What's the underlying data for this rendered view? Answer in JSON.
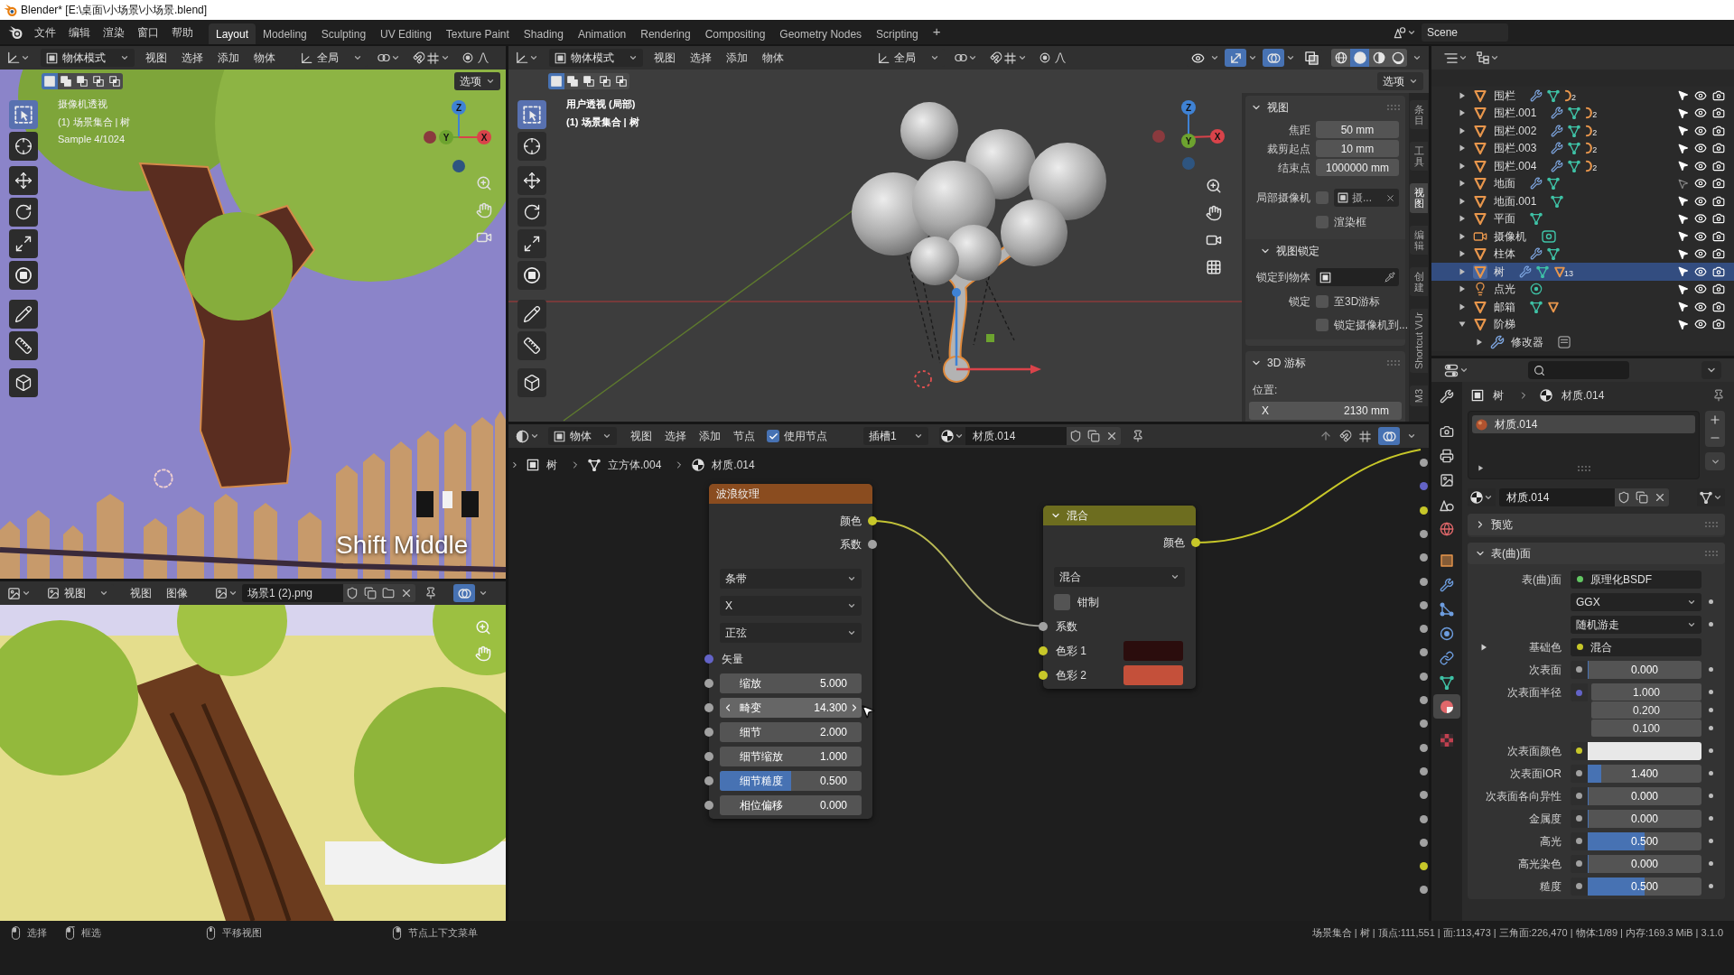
{
  "title_bar": {
    "title": "Blender* [E:\\桌面\\小场景\\小场景.blend]"
  },
  "top_bar": {
    "menus": [
      "文件",
      "编辑",
      "渲染",
      "窗口",
      "帮助"
    ],
    "workspaces": [
      {
        "label": "Layout",
        "selected": true
      },
      {
        "label": "Modeling",
        "selected": false
      },
      {
        "label": "Sculpting",
        "selected": false
      },
      {
        "label": "UV Editing",
        "selected": false
      },
      {
        "label": "Texture Paint",
        "selected": false
      },
      {
        "label": "Shading",
        "selected": false
      },
      {
        "label": "Animation",
        "selected": false
      },
      {
        "label": "Rendering",
        "selected": false
      },
      {
        "label": "Compositing",
        "selected": false
      },
      {
        "label": "Geometry Nodes",
        "selected": false
      },
      {
        "label": "Scripting",
        "selected": false
      }
    ],
    "add_workspace": "+",
    "scene": "Scene"
  },
  "camera_view": {
    "header": {
      "mode": "物体模式",
      "menus": [
        "视图",
        "选择",
        "添加",
        "物体"
      ],
      "orientation": "全局"
    },
    "select_modes": [
      {
        "kind": "set",
        "selected": true
      },
      {
        "kind": "extend",
        "selected": false
      },
      {
        "kind": "subtract",
        "selected": false
      },
      {
        "kind": "difference",
        "selected": false
      },
      {
        "kind": "intersect",
        "selected": false
      }
    ],
    "options": "选项",
    "tools": [
      {
        "kind": "select",
        "selected": true
      },
      {
        "kind": "cursor",
        "selected": false
      },
      {
        "kind": "move",
        "selected": false
      },
      {
        "kind": "rotate",
        "selected": false
      },
      {
        "kind": "scale",
        "selected": false
      },
      {
        "kind": "transform",
        "selected": false
      },
      {
        "kind": "annotate",
        "selected": false
      },
      {
        "kind": "measure",
        "selected": false
      },
      {
        "kind": "add_cube",
        "selected": false
      }
    ],
    "info": [
      "摄像机透视",
      "(1) 场景集合 | 树",
      "Sample 4/1024"
    ],
    "gizmo": {
      "labels": [
        {
          "kind": "z",
          "text": "Z"
        },
        {
          "kind": "y",
          "text": "Y"
        },
        {
          "kind": "x",
          "text": "X"
        }
      ]
    },
    "key_hint": {
      "text": "Shift Middle",
      "buttons": [
        {
          "pressed": false
        },
        {
          "pressed": true
        },
        {
          "pressed": false
        }
      ]
    }
  },
  "image_editor": {
    "header": {
      "mode": "视图",
      "menus": [
        "视图",
        "图像"
      ],
      "image": "场景1 (2).png"
    }
  },
  "viewport": {
    "header": {
      "mode": "物体模式",
      "menus": [
        "视图",
        "选择",
        "添加",
        "物体"
      ],
      "orientation": "全局",
      "toggles": [
        {
          "kind": "visibility",
          "selected": false
        },
        {
          "kind": "gizmo",
          "selected": true
        },
        {
          "kind": "overlay",
          "selected": true
        },
        {
          "kind": "xray",
          "selected": false
        }
      ],
      "shading_modes": [
        {
          "kind": "wireframe",
          "selected": false
        },
        {
          "kind": "solid",
          "selected": true
        },
        {
          "kind": "material",
          "selected": false
        },
        {
          "kind": "rendered",
          "selected": false
        }
      ]
    },
    "select_modes": [
      {
        "kind": "set",
        "selected": true
      },
      {
        "kind": "extend",
        "selected": false
      },
      {
        "kind": "subtract",
        "selected": false
      },
      {
        "kind": "difference",
        "selected": false
      },
      {
        "kind": "intersect",
        "selected": false
      }
    ],
    "options": "选项",
    "tools": [
      {
        "kind": "select",
        "selected": true
      },
      {
        "kind": "cursor",
        "selected": false
      },
      {
        "kind": "move",
        "selected": false
      },
      {
        "kind": "rotate",
        "selected": false
      },
      {
        "kind": "scale",
        "selected": false
      },
      {
        "kind": "transform",
        "selected": false
      },
      {
        "kind": "annotate",
        "selected": false
      },
      {
        "kind": "measure",
        "selected": false
      },
      {
        "kind": "add_cube",
        "selected": false
      }
    ],
    "info": [
      "用户透视 (局部)",
      "(1) 场景集合 | 树"
    ],
    "gizmo": {
      "labels": [
        {
          "kind": "z",
          "text": "Z"
        },
        {
          "kind": "y",
          "text": "Y"
        },
        {
          "kind": "x",
          "text": "X"
        }
      ]
    },
    "sidebar": {
      "tabs": [
        {
          "label": "条目",
          "kind": "stacked",
          "selected": false
        },
        {
          "label": "工具",
          "kind": "stacked",
          "selected": false
        },
        {
          "label": "视图",
          "kind": "stacked",
          "selected": true
        },
        {
          "label": "编辑",
          "kind": "stacked",
          "selected": false
        },
        {
          "label": "创建",
          "kind": "stacked",
          "selected": false
        },
        {
          "label": "Shortcut VUr",
          "kind": "rotated",
          "selected": false
        },
        {
          "label": "M3",
          "kind": "rotated",
          "selected": false
        }
      ],
      "panels": [
        {
          "title": "视图",
          "expanded": true,
          "rows": [
            {
              "kind": "value",
              "label": "焦距",
              "value": "50 mm"
            },
            {
              "kind": "value",
              "label": "裁剪起点",
              "value": "10 mm"
            },
            {
              "kind": "value",
              "label": "结束点",
              "value": "1000000 mm"
            },
            {
              "kind": "camera",
              "label": "局部摄像机",
              "checked": false,
              "value": "摄..."
            },
            {
              "kind": "check",
              "text": "渲染框",
              "checked": false
            }
          ],
          "subpanels": [
            {
              "title": "视图锁定",
              "expanded": true,
              "rows": [
                {
                  "kind": "object",
                  "label": "锁定到物体"
                },
                {
                  "kind": "check",
                  "label": "锁定",
                  "text": "至3D游标",
                  "checked": false
                },
                {
                  "kind": "check",
                  "text": "锁定摄像机到...",
                  "checked": false
                }
              ]
            }
          ]
        },
        {
          "title": "3D 游标",
          "expanded": true,
          "rows": [
            {
              "kind": "heading",
              "label": "位置:"
            },
            {
              "kind": "axis",
              "label": "X",
              "value": "2130 mm"
            }
          ]
        }
      ]
    }
  },
  "node_editor": {
    "header": {
      "mode": "物体",
      "menus": [
        "视图",
        "选择",
        "添加",
        "节点"
      ],
      "use_nodes": {
        "label": "使用节点",
        "checked": true
      },
      "slot": "插槽1",
      "material": "材质.014"
    },
    "breadcrumb": [
      "树",
      "立方体.004",
      "材质.014"
    ],
    "nodes": [
      {
        "kind": "texture",
        "title": "波浪纹理",
        "outputs": [
          {
            "label": "颜色",
            "socket": {
              "color": "#c7c729"
            }
          },
          {
            "label": "系数",
            "socket": {
              "color": "#a1a1a1"
            }
          }
        ],
        "dropdowns": [
          "条带",
          "X",
          "正弦"
        ],
        "inputs": [
          {
            "kind": "socket",
            "label": "矢量",
            "socket": {
              "color": "#6363c7"
            }
          },
          {
            "kind": "value",
            "label": "缩放",
            "value": "5.000",
            "socket": {
              "color": "#a1a1a1"
            },
            "hovered": false
          },
          {
            "kind": "value",
            "label": "畸变",
            "value": "14.300",
            "socket": {
              "color": "#a1a1a1"
            },
            "hovered": true
          },
          {
            "kind": "value",
            "label": "细节",
            "value": "2.000",
            "socket": {
              "color": "#a1a1a1"
            },
            "hovered": false
          },
          {
            "kind": "value",
            "label": "细节缩放",
            "value": "1.000",
            "socket": {
              "color": "#a1a1a1"
            },
            "hovered": false
          },
          {
            "kind": "factor",
            "label": "细节糙度",
            "value": "0.500",
            "level": 0.5,
            "socket": {
              "color": "#a1a1a1"
            },
            "hovered": false
          },
          {
            "kind": "value",
            "label": "相位偏移",
            "value": "0.000",
            "socket": {
              "color": "#a1a1a1"
            },
            "hovered": false
          }
        ]
      },
      {
        "kind": "color",
        "title": "混合",
        "expanded": true,
        "outputs": [
          {
            "label": "颜色",
            "socket": {
              "color": "#c7c729"
            }
          }
        ],
        "dropdowns": [
          "混合"
        ],
        "checkboxes": [
          {
            "label": "钳制",
            "checked": false
          }
        ],
        "inputs": [
          {
            "kind": "socket",
            "label": "系数",
            "socket": {
              "color": "#a1a1a1"
            }
          },
          {
            "kind": "color",
            "label": "色彩 1",
            "socket": {
              "color": "#c7c729"
            },
            "color": "#2b0d0d"
          },
          {
            "kind": "color",
            "label": "色彩 2",
            "socket": {
              "color": "#c7c729"
            },
            "color": "#c4503a"
          }
        ]
      }
    ],
    "edge_sockets": [
      {
        "color": "#a1a1a1"
      },
      {
        "color": "#6363c7"
      },
      {
        "color": "#c7c729"
      },
      {
        "color": "#a1a1a1"
      },
      {
        "color": "#a1a1a1"
      },
      {
        "color": "#a1a1a1"
      },
      {
        "color": "#a1a1a1"
      },
      {
        "color": "#a1a1a1"
      },
      {
        "color": "#a1a1a1"
      },
      {
        "color": "#a1a1a1"
      },
      {
        "color": "#a1a1a1"
      },
      {
        "color": "#a1a1a1"
      },
      {
        "color": "#a1a1a1"
      },
      {
        "color": "#a1a1a1"
      },
      {
        "color": "#a1a1a1"
      },
      {
        "color": "#a1a1a1"
      },
      {
        "color": "#a1a1a1"
      },
      {
        "color": "#c7c729"
      },
      {
        "color": "#a1a1a1"
      }
    ]
  },
  "outliner": {
    "rows": [
      {
        "name": "围栏",
        "kind": "mesh",
        "expanded": false,
        "selected": false,
        "selectable": true,
        "data": [
          {
            "kind": "modifier"
          },
          {
            "kind": "mesh_data"
          },
          {
            "kind": "hook",
            "count": "2"
          }
        ]
      },
      {
        "name": "围栏.001",
        "kind": "mesh",
        "expanded": false,
        "selected": false,
        "selectable": true,
        "data": [
          {
            "kind": "modifier"
          },
          {
            "kind": "mesh_data"
          },
          {
            "kind": "hook",
            "count": "2"
          }
        ]
      },
      {
        "name": "围栏.002",
        "kind": "mesh",
        "expanded": false,
        "selected": false,
        "selectable": true,
        "data": [
          {
            "kind": "modifier"
          },
          {
            "kind": "mesh_data"
          },
          {
            "kind": "hook",
            "count": "2"
          }
        ]
      },
      {
        "name": "围栏.003",
        "kind": "mesh",
        "expanded": false,
        "selected": false,
        "selectable": true,
        "data": [
          {
            "kind": "modifier"
          },
          {
            "kind": "mesh_data"
          },
          {
            "kind": "hook",
            "count": "2"
          }
        ]
      },
      {
        "name": "围栏.004",
        "kind": "mesh",
        "expanded": false,
        "selected": false,
        "selectable": true,
        "data": [
          {
            "kind": "modifier"
          },
          {
            "kind": "mesh_data"
          },
          {
            "kind": "hook",
            "count": "2"
          }
        ]
      },
      {
        "name": "地面",
        "kind": "mesh",
        "expanded": false,
        "selected": false,
        "selectable": false,
        "data": [
          {
            "kind": "modifier"
          },
          {
            "kind": "mesh_data"
          }
        ]
      },
      {
        "name": "地面.001",
        "kind": "mesh",
        "expanded": false,
        "selected": false,
        "selectable": true,
        "data": [
          {
            "kind": "mesh_data"
          }
        ]
      },
      {
        "name": "平面",
        "kind": "mesh",
        "expanded": false,
        "selected": false,
        "selectable": true,
        "data": [
          {
            "kind": "mesh_data"
          }
        ]
      },
      {
        "name": "摄像机",
        "kind": "camera",
        "expanded": false,
        "selected": false,
        "selectable": true,
        "data": [
          {
            "kind": "camera_data"
          }
        ]
      },
      {
        "name": "柱体",
        "kind": "mesh",
        "expanded": false,
        "selected": false,
        "selectable": true,
        "data": [
          {
            "kind": "modifier"
          },
          {
            "kind": "mesh_data"
          }
        ]
      },
      {
        "name": "树",
        "kind": "mesh",
        "expanded": false,
        "selected": true,
        "selectable": true,
        "data": [
          {
            "kind": "modifier"
          },
          {
            "kind": "mesh_data"
          },
          {
            "kind": "object",
            "count": "13"
          }
        ]
      },
      {
        "name": "点光",
        "kind": "light",
        "expanded": false,
        "selected": false,
        "selectable": true,
        "data": [
          {
            "kind": "light_data"
          }
        ]
      },
      {
        "name": "邮箱",
        "kind": "mesh",
        "expanded": false,
        "selected": false,
        "selectable": true,
        "data": [
          {
            "kind": "mesh_data"
          },
          {
            "kind": "object"
          }
        ]
      },
      {
        "name": "阶梯",
        "kind": "mesh",
        "expanded": true,
        "selected": false,
        "selectable": true,
        "children": [
          {
            "name": "修改器",
            "kind": "modifiers",
            "expanded": false,
            "selected": false,
            "data": [
              {
                "kind": "modifier_stack"
              }
            ]
          }
        ]
      }
    ]
  },
  "properties": {
    "tabs": [
      {
        "kind": "tool",
        "selected": false
      },
      {
        "kind": "render",
        "selected": false
      },
      {
        "kind": "output",
        "selected": false
      },
      {
        "kind": "view_layer",
        "selected": false
      },
      {
        "kind": "scene",
        "selected": false
      },
      {
        "kind": "world",
        "selected": false
      },
      {
        "kind": "object",
        "selected": false
      },
      {
        "kind": "modifiers",
        "selected": false
      },
      {
        "kind": "particles",
        "selected": false
      },
      {
        "kind": "physics",
        "selected": false
      },
      {
        "kind": "constraints",
        "selected": false
      },
      {
        "kind": "data",
        "selected": false
      },
      {
        "kind": "material",
        "selected": true
      },
      {
        "kind": "texture",
        "selected": false
      }
    ],
    "breadcrumb": [
      "树",
      "材质.014"
    ],
    "slots": [
      {
        "name": "材质.014",
        "selected": true
      }
    ],
    "material": "材质.014",
    "panels": [
      {
        "title": "预览",
        "expanded": false
      },
      {
        "title": "表(曲)面",
        "expanded": true,
        "rows": [
          {
            "kind": "link",
            "label": "表(曲)面",
            "value": "原理化BSDF",
            "socket": {
              "color": "#63c763"
            }
          },
          {
            "kind": "dropdown",
            "value": "GGX"
          },
          {
            "kind": "dropdown",
            "value": "随机游走"
          },
          {
            "kind": "link",
            "label": "基础色",
            "value": "混合",
            "socket": {
              "color": "#c7c729"
            },
            "expanded": false
          },
          {
            "kind": "factor",
            "label": "次表面",
            "value": "0.000",
            "level": 0,
            "socket": {
              "color": "#a1a1a1"
            }
          },
          {
            "kind": "vector",
            "label": "次表面半径",
            "values": [
              "1.000",
              "0.200",
              "0.100"
            ],
            "socket": {
              "color": "#6363c7"
            }
          },
          {
            "kind": "color",
            "label": "次表面颜色",
            "color": "#e8e8e8",
            "socket": {
              "color": "#c7c729"
            }
          },
          {
            "kind": "factor",
            "label": "次表面IOR",
            "value": "1.400",
            "level": 0.12,
            "socket": {
              "color": "#a1a1a1"
            }
          },
          {
            "kind": "factor",
            "label": "次表面各向异性",
            "value": "0.000",
            "level": 0,
            "socket": {
              "color": "#a1a1a1"
            }
          },
          {
            "kind": "factor",
            "label": "金属度",
            "value": "0.000",
            "level": 0,
            "socket": {
              "color": "#a1a1a1"
            }
          },
          {
            "kind": "factor",
            "label": "高光",
            "value": "0.500",
            "level": 0.5,
            "socket": {
              "color": "#a1a1a1"
            }
          },
          {
            "kind": "factor",
            "label": "高光染色",
            "value": "0.000",
            "level": 0,
            "socket": {
              "color": "#a1a1a1"
            }
          },
          {
            "kind": "factor",
            "label": "糙度",
            "value": "0.500",
            "level": 0.5,
            "socket": {
              "color": "#a1a1a1"
            }
          }
        ]
      }
    ]
  },
  "status_bar": {
    "hints": [
      {
        "kind": "left",
        "label": "选择"
      },
      {
        "kind": "left_drag",
        "label": "框选"
      },
      {
        "kind": "middle",
        "label": "平移视图"
      },
      {
        "kind": "right",
        "label": "节点上下文菜单"
      }
    ],
    "stats": "场景集合 | 树 | 顶点:111,551 | 面:113,473 | 三角面:226,470 | 物体:1/89 | 内存:169.3 MiB | 3.1.0"
  }
}
